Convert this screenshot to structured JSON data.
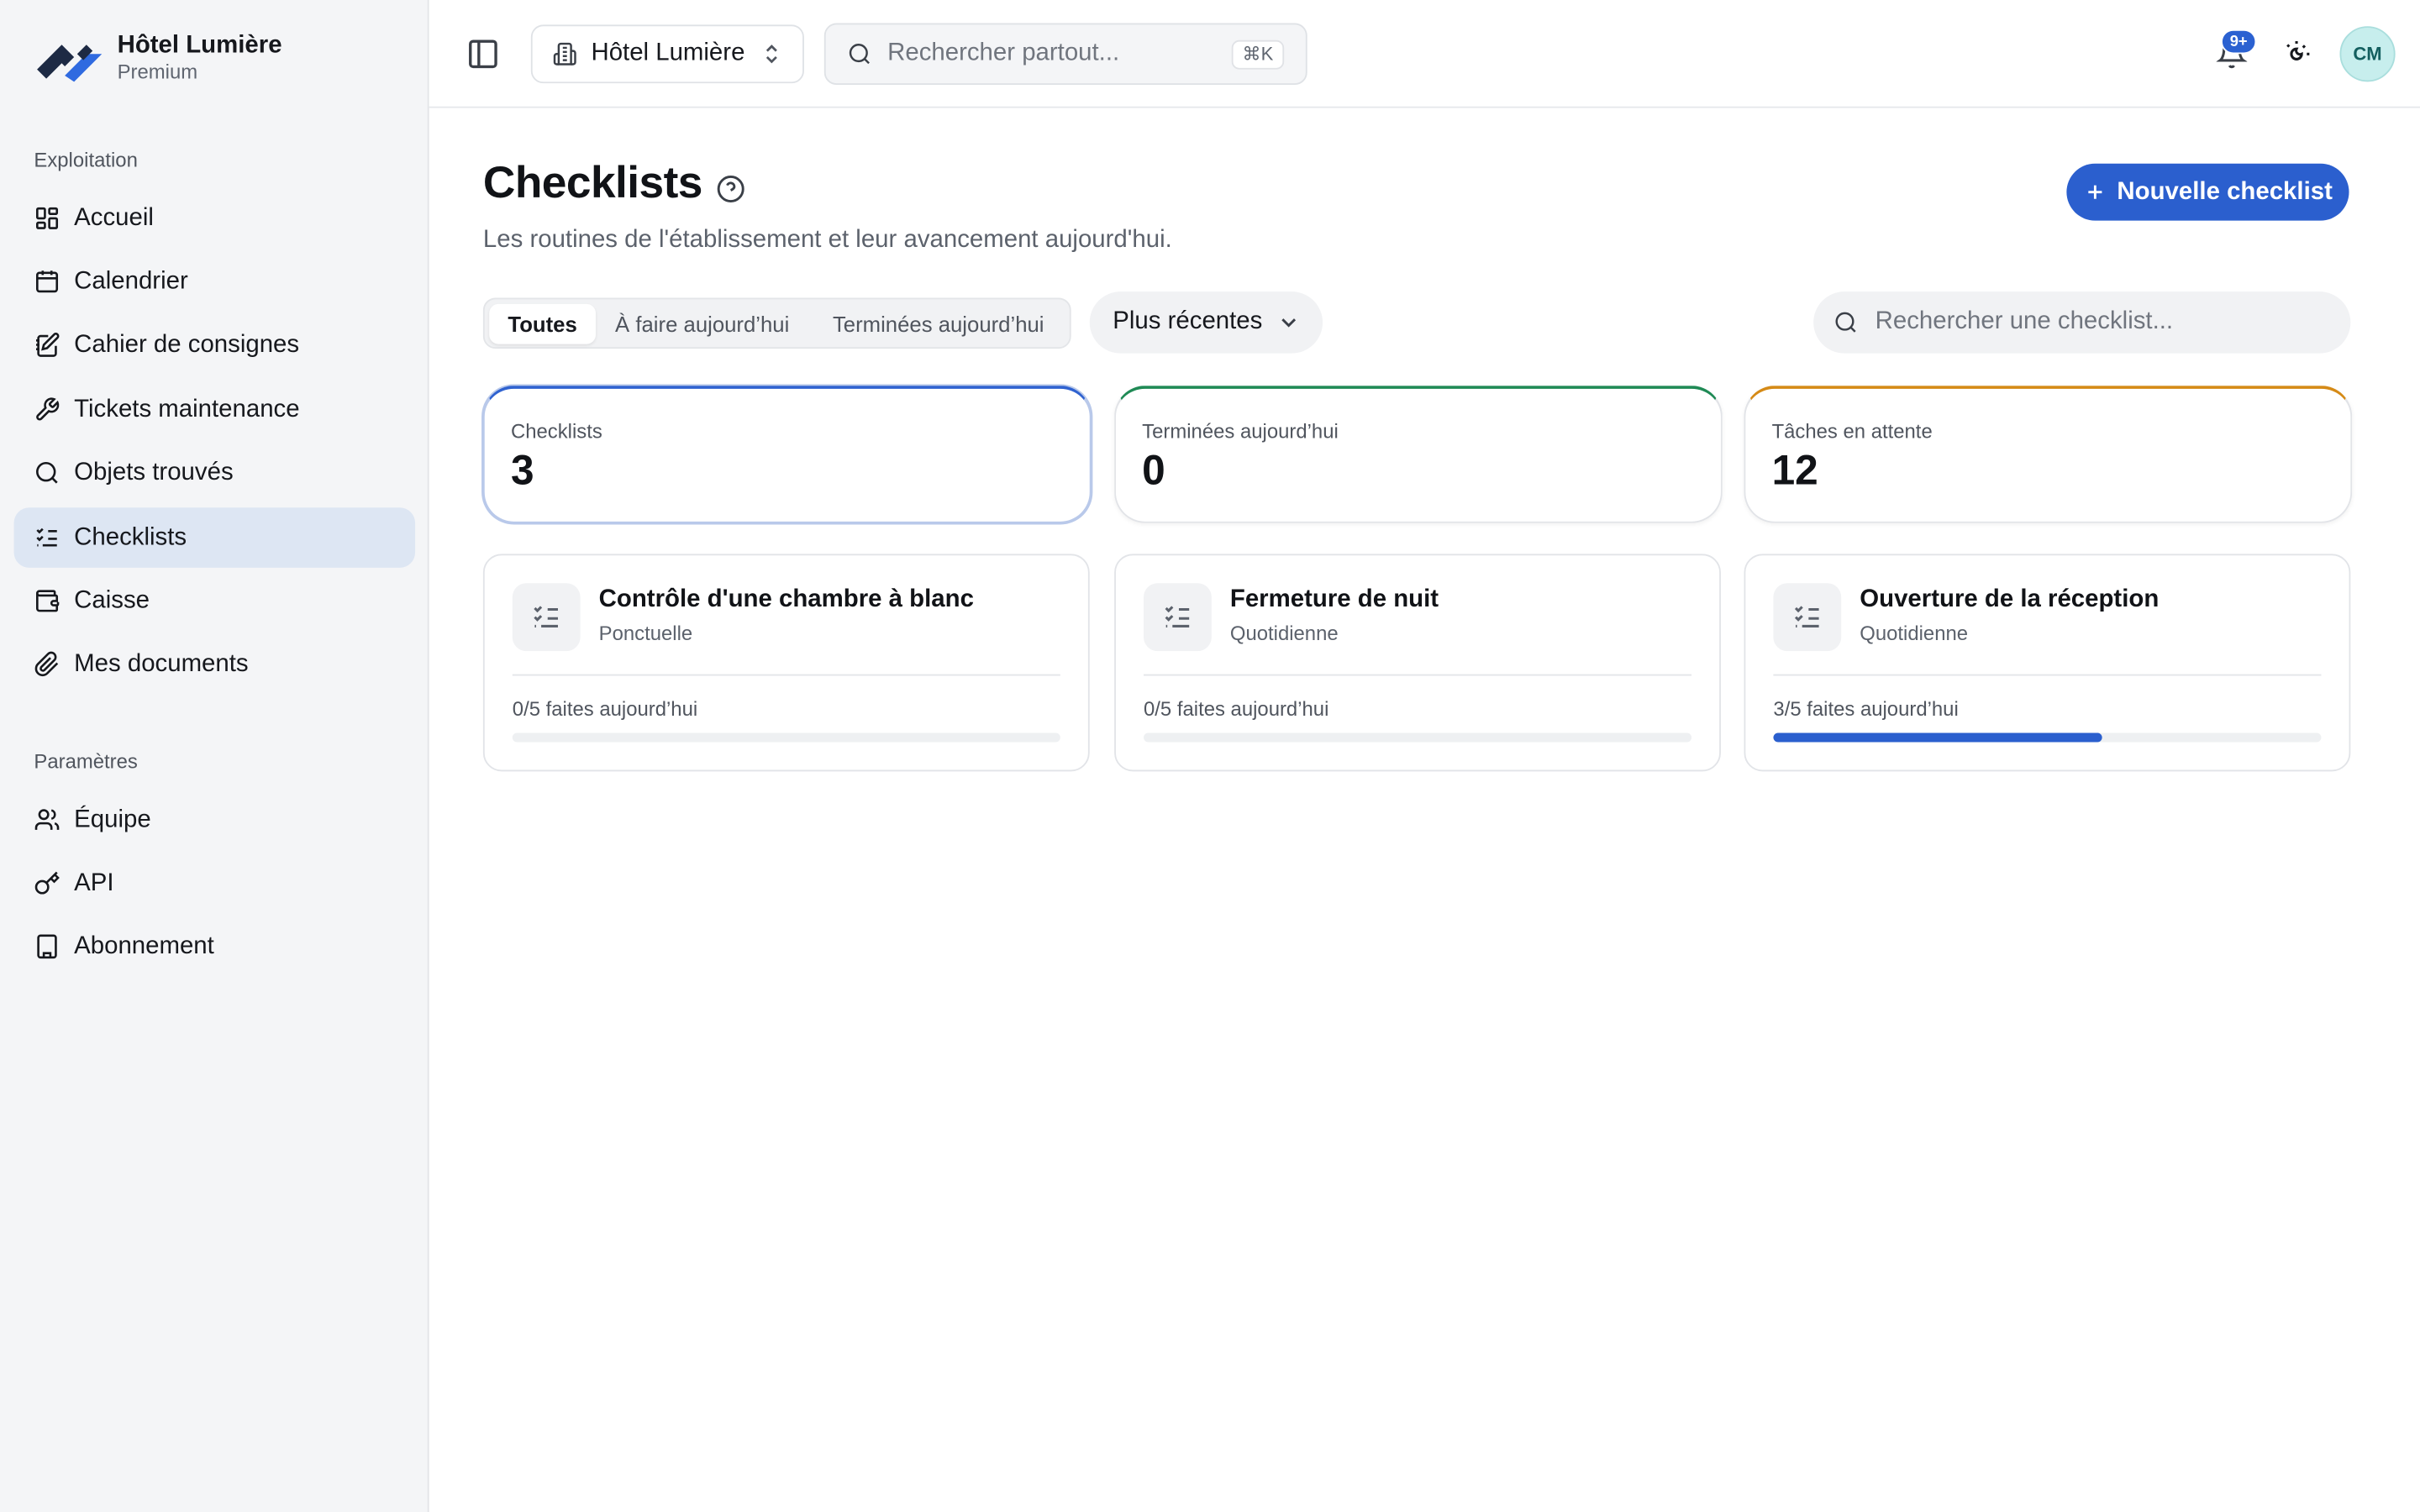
{
  "brand": {
    "name": "Hôtel Lumière",
    "plan": "Premium"
  },
  "sidebar": {
    "section_ops": "Exploitation",
    "ops_items": [
      {
        "label": "Accueil",
        "icon": "dashboard-icon"
      },
      {
        "label": "Calendrier",
        "icon": "calendar-icon"
      },
      {
        "label": "Cahier de consignes",
        "icon": "notebook-icon"
      },
      {
        "label": "Tickets maintenance",
        "icon": "wrench-icon"
      },
      {
        "label": "Objets trouvés",
        "icon": "search-icon"
      },
      {
        "label": "Checklists",
        "icon": "checklist-icon",
        "active": true
      },
      {
        "label": "Caisse",
        "icon": "wallet-icon"
      },
      {
        "label": "Mes documents",
        "icon": "paperclip-icon"
      }
    ],
    "section_settings": "Paramètres",
    "settings_items": [
      {
        "label": "Équipe",
        "icon": "users-icon"
      },
      {
        "label": "API",
        "icon": "key-icon"
      },
      {
        "label": "Abonnement",
        "icon": "building-icon"
      }
    ]
  },
  "topbar": {
    "hotel_select": "Hôtel Lumière",
    "search_placeholder": "Rechercher partout...",
    "search_shortcut": "⌘K",
    "notifications_badge": "9+",
    "avatar_initials": "CM"
  },
  "page": {
    "title": "Checklists",
    "subtitle": "Les routines de l'établissement et leur avancement aujourd'hui.",
    "new_button": "Nouvelle checklist"
  },
  "filters": {
    "tabs": [
      "Toutes",
      "À faire aujourd’hui",
      "Terminées aujourd’hui"
    ],
    "active_tab": 0,
    "sort": "Plus récentes",
    "search_placeholder": "Rechercher une checklist..."
  },
  "stats": [
    {
      "label": "Checklists",
      "value": "3",
      "accent": "#2f62d0"
    },
    {
      "label": "Terminées aujourd’hui",
      "value": "0",
      "accent": "#1f8a55"
    },
    {
      "label": "Tâches en attente",
      "value": "12",
      "accent": "#d58a16"
    }
  ],
  "checklists": [
    {
      "title": "Contrôle d'une chambre à blanc",
      "frequency": "Ponctuelle",
      "progress_text": "0/5 faites aujourd’hui",
      "done": 0,
      "total": 5
    },
    {
      "title": "Fermeture de nuit",
      "frequency": "Quotidienne",
      "progress_text": "0/5 faites aujourd’hui",
      "done": 0,
      "total": 5
    },
    {
      "title": "Ouverture de la réception",
      "frequency": "Quotidienne",
      "progress_text": "3/5 faites aujourd’hui",
      "done": 3,
      "total": 5
    }
  ],
  "colors": {
    "accent": "#2b5fce",
    "sidebar_bg": "#f4f5f7",
    "active_nav": "#dde6f3"
  }
}
